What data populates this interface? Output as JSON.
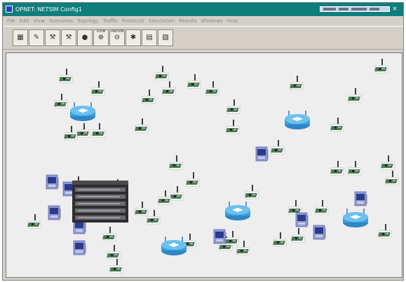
{
  "window": {
    "title": "OPNET: NETSIM Config1",
    "close_glyph": "×"
  },
  "menu": [
    "File",
    "Edit",
    "View",
    "Scenarios",
    "Topology",
    "Traffic",
    "Protocols",
    "Simulation",
    "Results",
    "Windows",
    "Help"
  ],
  "toolbar": {
    "buttons": [
      {
        "name": "open-palette-button",
        "icon": "palette-icon",
        "glyph": "▦",
        "label": ""
      },
      {
        "name": "configure-link-button",
        "icon": "link-tool-icon",
        "glyph": "✎",
        "label": ""
      },
      {
        "name": "node-config-button",
        "icon": "nodes-icon",
        "glyph": "⚒",
        "label": ""
      },
      {
        "name": "network-config-button",
        "icon": "network-icon",
        "glyph": "⚒",
        "label": ""
      },
      {
        "name": "failure-button",
        "icon": "failure-icon",
        "glyph": "●",
        "label": ""
      },
      {
        "name": "zoom-in-button",
        "icon": "zoom-in-icon",
        "glyph": "⊕",
        "label": "ZOOM"
      },
      {
        "name": "zoom-out-button",
        "icon": "zoom-out-icon",
        "glyph": "⊖",
        "label": "UNZOOM"
      },
      {
        "name": "run-simulation-button",
        "icon": "run-simulation-icon",
        "glyph": "✱",
        "label": ""
      },
      {
        "name": "view-results-button",
        "icon": "results-icon",
        "glyph": "▤",
        "label": ""
      },
      {
        "name": "web-report-button",
        "icon": "report-icon",
        "glyph": "▧",
        "label": ""
      }
    ]
  },
  "canvas": {
    "switch_label": "",
    "node_label": "",
    "router_label": ""
  },
  "colors": {
    "titlebar": "#0f7e7c",
    "canvas": "#eeeeee",
    "router": "#3aa0dc",
    "sensor_board": "#4d7a55",
    "workstation": "#8e9ad6"
  }
}
